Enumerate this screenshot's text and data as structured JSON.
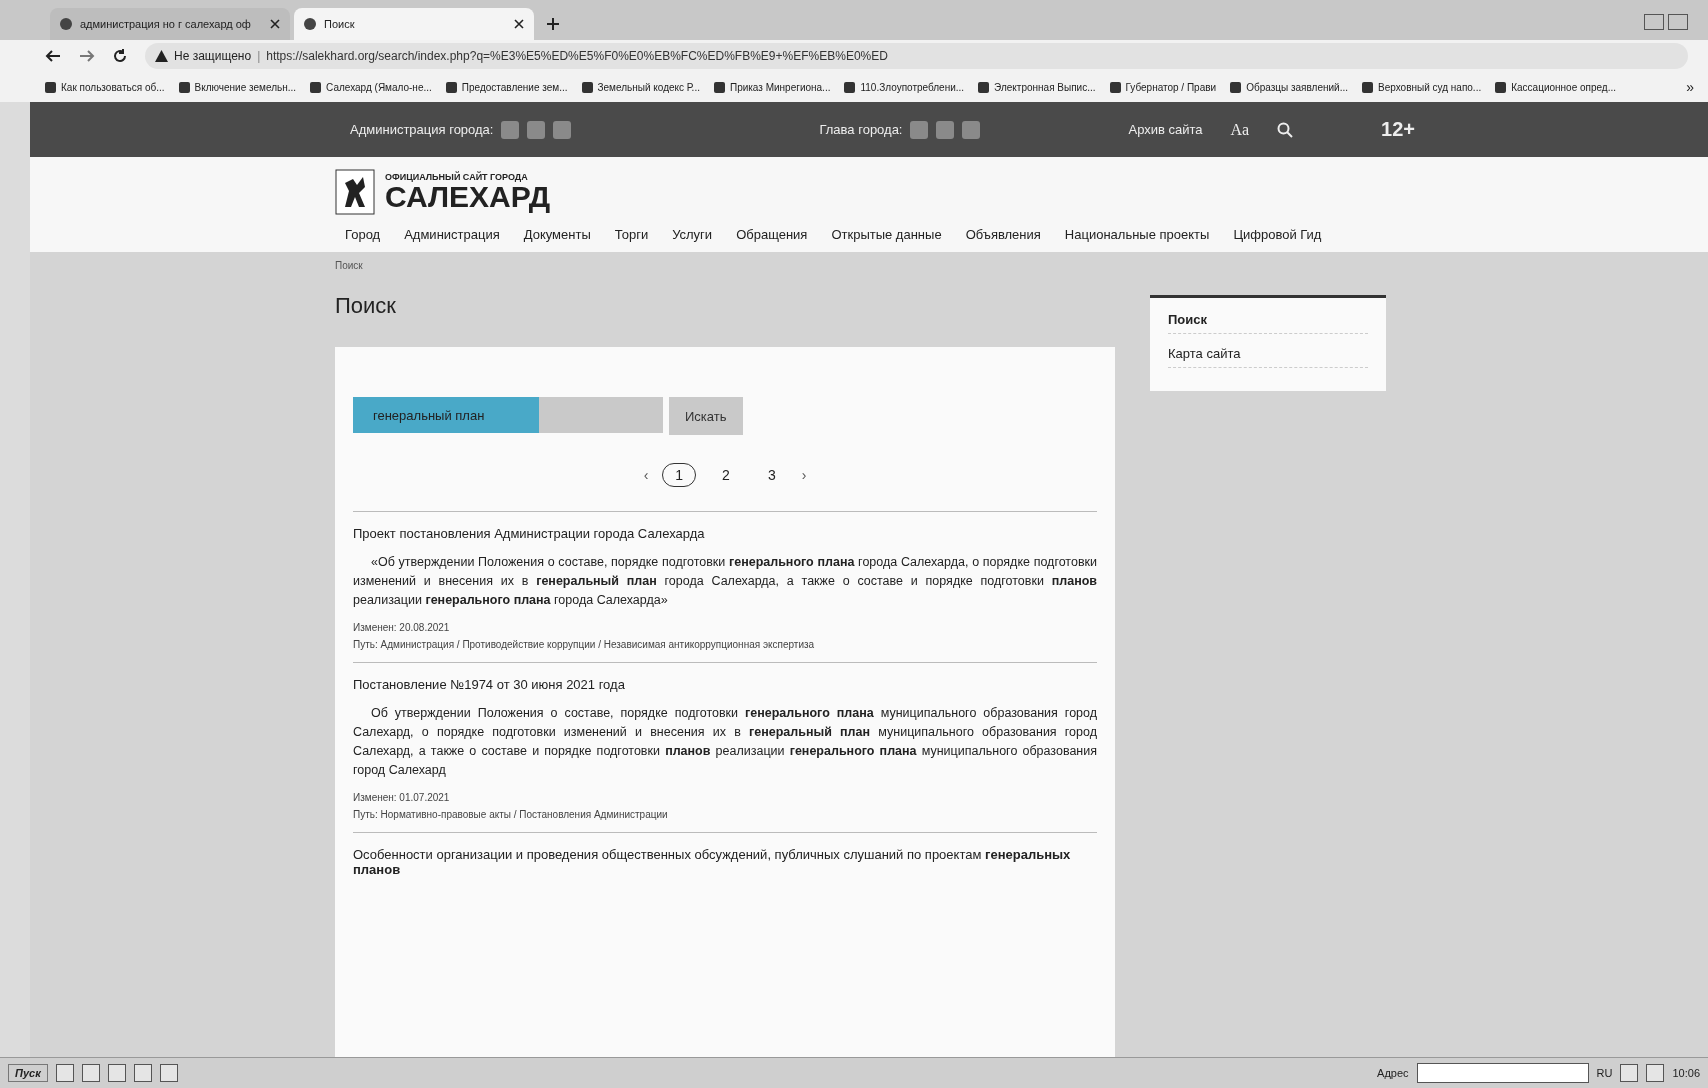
{
  "browser": {
    "tabs": [
      {
        "title": "администрация но г салехард оф",
        "selected": false
      },
      {
        "title": "Поиск",
        "selected": true
      }
    ],
    "security": "Не защищено",
    "separator": "|",
    "url": "https://salekhard.org/search/index.php?q=%E3%E5%ED%E5%F0%E0%EB%FC%ED%FB%E9+%EF%EB%E0%ED",
    "bookmarks": [
      "Как пользоваться об...",
      "Включение земельн...",
      "Салехард (Ямало-не...",
      "Предоставление зем...",
      "Земельный кодекс Р...",
      "Приказ Минрегиона...",
      "110.Злоупотреблени...",
      "Электронная Выпис...",
      "Губернатор / Прави",
      "Образцы заявлений...",
      "Верховный суд напо...",
      "Кассационное опред..."
    ],
    "bookmarks_more": "»"
  },
  "topbar": {
    "admin_label": "Администрация города:",
    "head_label": "Глава города:",
    "archive": "Архив сайта",
    "font_size": "Аа",
    "age": "12+"
  },
  "logo": {
    "subtitle": "ОФИЦИАЛЬНЫЙ САЙТ ГОРОДА",
    "title": "САЛЕХАРД"
  },
  "nav": [
    "Город",
    "Администрация",
    "Документы",
    "Торги",
    "Услуги",
    "Обращения",
    "Открытые данные",
    "Объявления",
    "Национальные проекты",
    "Цифровой Гид"
  ],
  "breadcrumb": "Поиск",
  "page_title": "Поиск",
  "sidebar": [
    {
      "label": "Поиск",
      "selected": true
    },
    {
      "label": "Карта сайта",
      "selected": false
    }
  ],
  "search": {
    "value": "генеральный план",
    "button": "Искать"
  },
  "pagination": {
    "prev": "‹",
    "next": "›",
    "pages": [
      {
        "label": "1",
        "selected": true
      },
      {
        "label": "2",
        "selected": false
      },
      {
        "label": "3",
        "selected": false
      }
    ]
  },
  "results": [
    {
      "title": "Проект постановления Администрации города Салехарда",
      "text": "«Об утверждении Положения о составе, порядке подготовки **генерального плана** города Салехарда, о порядке подготовки изменений и внесения их в **генеральный план** города Салехарда, а также о составе и порядке подготовки **планов** реализации **генерального плана** города Салехарда»",
      "changed": "Изменен: 20.08.2021",
      "path": "Путь: Администрация / Противодействие коррупции / Независимая антикоррупционная экспертиза"
    },
    {
      "title": "Постановление №1974 от 30 июня 2021 года",
      "text": "Об утверждении Положения о составе, порядке подготовки **генерального плана** муниципального образования город Салехард, о порядке подготовки изменений и внесения их в **генеральный план** муниципального образования город Салехард, а также о составе и порядке подготовки **планов** реализации **генерального плана** муниципального образования город Салехард",
      "changed": "Изменен: 01.07.2021",
      "path": "Путь: Нормативно-правовые акты / Постановления Администрации"
    },
    {
      "title": "Особенности организации и проведения общественных обсуждений, публичных слушаний по проектам **генеральных планов**"
    }
  ],
  "taskbar": {
    "start": "Пуск",
    "address_label": "Адрес",
    "lang": "RU",
    "clock": "10:06"
  }
}
